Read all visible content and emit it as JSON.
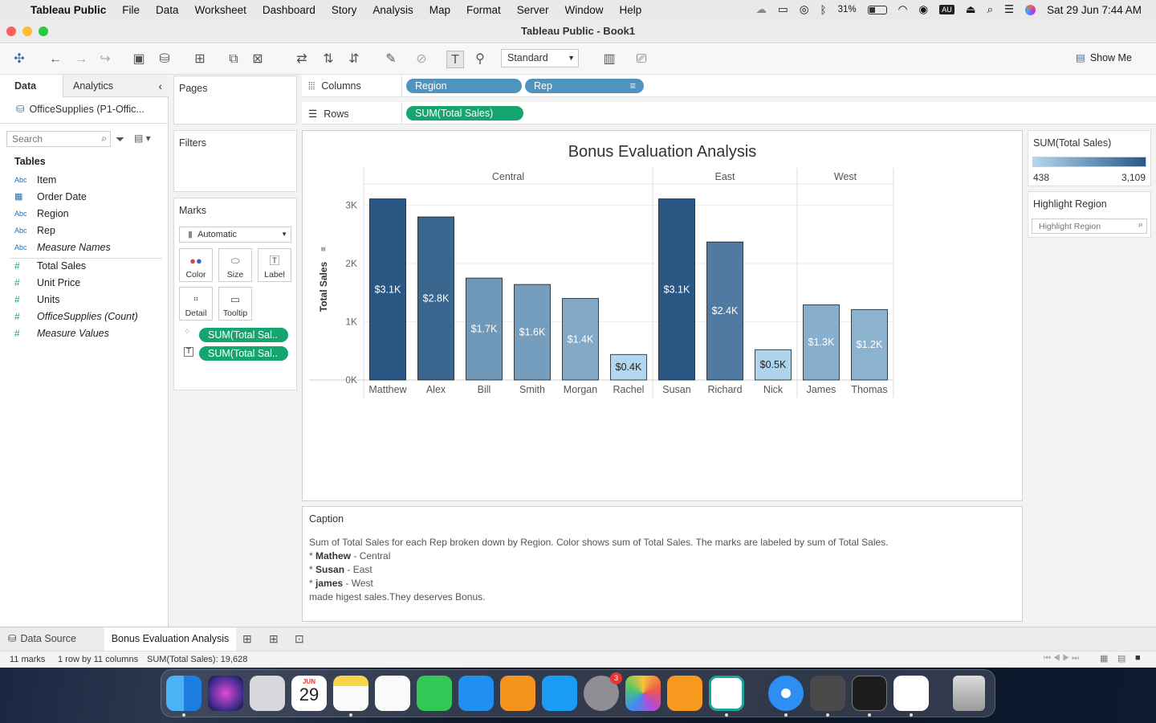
{
  "menubar": {
    "app": "Tableau Public",
    "items": [
      "File",
      "Data",
      "Worksheet",
      "Dashboard",
      "Story",
      "Analysis",
      "Map",
      "Format",
      "Server",
      "Window",
      "Help"
    ],
    "battery": "31%",
    "input_badge": "AU",
    "datetime": "Sat 29 Jun  7:44 AM"
  },
  "window": {
    "title": "Tableau Public - Book1"
  },
  "toolbar": {
    "fit_select": "Standard",
    "show_me": "Show Me"
  },
  "left": {
    "tab_data": "Data",
    "tab_analytics": "Analytics",
    "datasource": "OfficeSupplies (P1-Offic...",
    "search_placeholder": "Search",
    "tables_heading": "Tables",
    "dimensions": [
      {
        "type": "Abc",
        "name": "Item"
      },
      {
        "type": "date",
        "name": "Order Date"
      },
      {
        "type": "Abc",
        "name": "Region"
      },
      {
        "type": "Abc",
        "name": "Rep"
      },
      {
        "type": "Abc",
        "name": "Measure Names"
      }
    ],
    "measures": [
      {
        "name": "Total  Sales"
      },
      {
        "name": "Unit Price"
      },
      {
        "name": "Units"
      },
      {
        "name": "OfficeSupplies (Count)"
      },
      {
        "name": "Measure Values"
      }
    ]
  },
  "cards": {
    "pages": "Pages",
    "filters": "Filters",
    "marks": "Marks",
    "mark_type": "Automatic",
    "mark_buttons": [
      "Color",
      "Size",
      "Label",
      "Detail",
      "Tooltip"
    ],
    "mark_pills": [
      "SUM(Total  Sal..",
      "SUM(Total  Sal.."
    ]
  },
  "shelves": {
    "columns_label": "Columns",
    "rows_label": "Rows",
    "columns_pills": [
      "Region",
      "Rep"
    ],
    "rows_pills": [
      "SUM(Total  Sales)"
    ]
  },
  "chart_data": {
    "type": "bar",
    "title": "Bonus Evaluation Analysis",
    "ylabel": "Total  Sales",
    "yticks": [
      "0K",
      "1K",
      "2K",
      "3K"
    ],
    "ylim": [
      0,
      3200
    ],
    "groups": [
      {
        "name": "Central",
        "categories": [
          "Matthew",
          "Alex",
          "Bill",
          "Smith",
          "Morgan",
          "Rachel"
        ],
        "values": [
          3109,
          2800,
          1750,
          1640,
          1400,
          438
        ],
        "labels": [
          "$3.1K",
          "$2.8K",
          "$1.7K",
          "$1.6K",
          "$1.4K",
          "$0.4K"
        ]
      },
      {
        "name": "East",
        "categories": [
          "Susan",
          "Richard",
          "Nick"
        ],
        "values": [
          3109,
          2370,
          520
        ],
        "labels": [
          "$3.1K",
          "$2.4K",
          "$0.5K"
        ]
      },
      {
        "name": "West",
        "categories": [
          "James",
          "Thomas"
        ],
        "values": [
          1290,
          1210
        ],
        "labels": [
          "$1.3K",
          "$1.2K"
        ]
      }
    ],
    "color_min": 438,
    "color_max": 3109,
    "color_low": "#b3d7ee",
    "color_high": "#2a5783"
  },
  "legend": {
    "title": "SUM(Total  Sales)",
    "min": "438",
    "max": "3,109"
  },
  "highlight": {
    "title": "Highlight Region",
    "placeholder": "Highlight Region"
  },
  "caption": {
    "title": "Caption",
    "summary": "Sum of Total  Sales for each Rep broken down by Region.  Color shows sum of Total  Sales.  The marks are labeled by sum of Total  Sales.",
    "items": [
      {
        "name": "Mathew",
        "region": " - Central"
      },
      {
        "name": "Susan",
        "region": " - East"
      },
      {
        "name": "james",
        "region": " - West"
      }
    ],
    "footer": "made higest sales.They deserves Bonus."
  },
  "sheettabs": {
    "datasource": "Data Source",
    "active": "Bonus Evaluation Analysis"
  },
  "status": {
    "marks": "11 marks",
    "dims": "1 row by 11 columns",
    "sum": "SUM(Total  Sales): 19,628"
  },
  "dock": {
    "calendar_month": "JUN",
    "calendar_day": "29",
    "settings_badge": "3"
  }
}
